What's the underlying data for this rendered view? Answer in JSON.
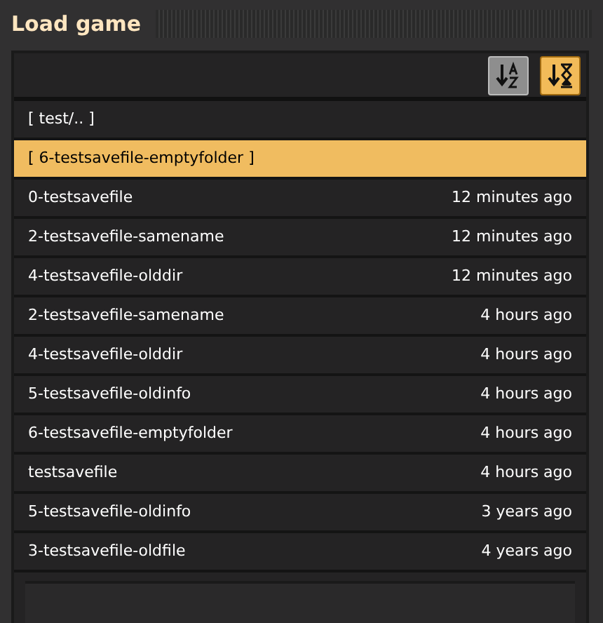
{
  "window": {
    "title": "Load game"
  },
  "sort_buttons": [
    {
      "kind": "name",
      "selected": false
    },
    {
      "kind": "time",
      "selected": true
    }
  ],
  "rows": [
    {
      "name": "[ test/.. ]",
      "selected": false
    },
    {
      "name": "[ 6-testsavefile-emptyfolder ]",
      "selected": true
    },
    {
      "name": "0-testsavefile",
      "time": "12 minutes ago",
      "selected": false
    },
    {
      "name": "2-testsavefile-samename",
      "time": "12 minutes ago",
      "selected": false
    },
    {
      "name": "4-testsavefile-olddir",
      "time": "12 minutes ago",
      "selected": false
    },
    {
      "name": "2-testsavefile-samename",
      "time": "4 hours ago",
      "selected": false
    },
    {
      "name": "4-testsavefile-olddir",
      "time": "4 hours ago",
      "selected": false
    },
    {
      "name": "5-testsavefile-oldinfo",
      "time": "4 hours ago",
      "selected": false
    },
    {
      "name": "6-testsavefile-emptyfolder",
      "time": "4 hours ago",
      "selected": false
    },
    {
      "name": "testsavefile",
      "time": "4 hours ago",
      "selected": false
    },
    {
      "name": "5-testsavefile-oldinfo",
      "time": "3 years ago",
      "selected": false
    },
    {
      "name": "3-testsavefile-oldfile",
      "time": "4 years ago",
      "selected": false
    }
  ]
}
